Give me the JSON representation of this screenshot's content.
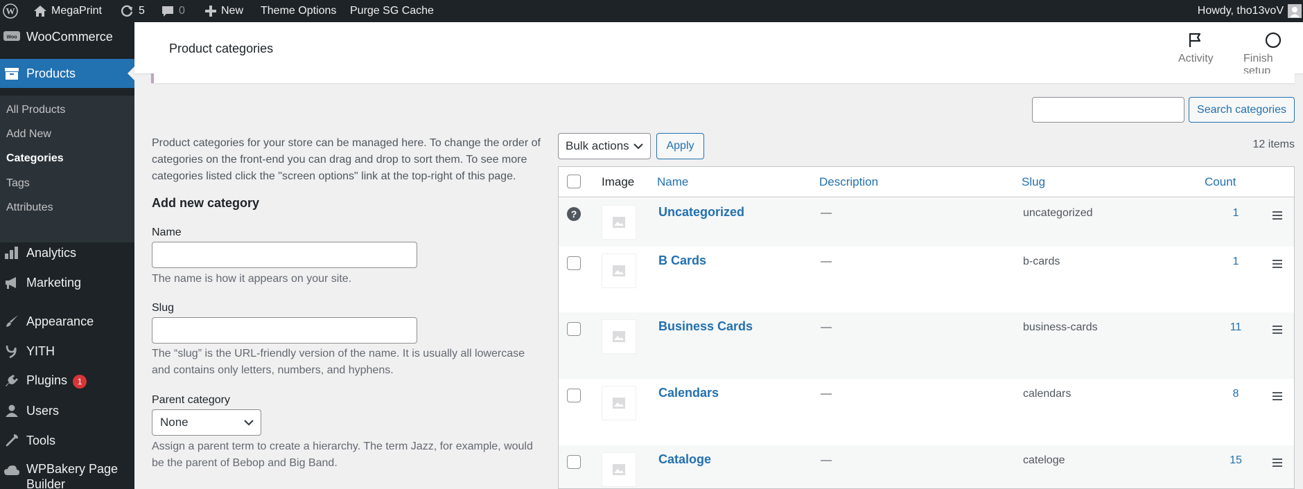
{
  "admin_bar": {
    "site_name": "MegaPrint",
    "updates_count": "5",
    "comments_count": "0",
    "new_label": "New",
    "theme_options": "Theme Options",
    "purge_cache": "Purge SG Cache",
    "greeting": "Howdy, tho13voV"
  },
  "sidebar": {
    "items": [
      {
        "label": "WooCommerce",
        "icon": "woo-icon"
      },
      {
        "label": "Products",
        "icon": "archive-icon"
      },
      {
        "label": "Analytics",
        "icon": "bar-chart-icon"
      },
      {
        "label": "Marketing",
        "icon": "megaphone-icon"
      },
      {
        "label": "Appearance",
        "icon": "paintbrush-icon"
      },
      {
        "label": "YITH",
        "icon": "yith-icon"
      },
      {
        "label": "Plugins",
        "icon": "plug-icon",
        "badge": "1"
      },
      {
        "label": "Users",
        "icon": "user-icon"
      },
      {
        "label": "Tools",
        "icon": "wrench-icon"
      },
      {
        "label": "WPBakery Page Builder",
        "icon": "cloud-icon"
      }
    ],
    "submenu": [
      "All Products",
      "Add New",
      "Categories",
      "Tags",
      "Attributes"
    ]
  },
  "header": {
    "title": "Product categories",
    "activity_label": "Activity",
    "finish_setup_label": "Finish setup"
  },
  "search": {
    "value": "",
    "button_label": "Search categories"
  },
  "form": {
    "intro": "Product categories for your store can be managed here. To change the order of categories on the front-end you can drag and drop to sort them. To see more categories listed click the \"screen options\" link at the top-right of this page.",
    "title": "Add new category",
    "name_label": "Name",
    "name_help": "The name is how it appears on your site.",
    "slug_label": "Slug",
    "slug_help": "The “slug” is the URL-friendly version of the name. It is usually all lowercase and contains only letters, numbers, and hyphens.",
    "parent_label": "Parent category",
    "parent_value": "None",
    "parent_help": "Assign a parent term to create a hierarchy. The term Jazz, for example, would be the parent of Bebop and Big Band."
  },
  "table": {
    "bulk_actions": "Bulk actions",
    "apply_label": "Apply",
    "items_count": "12 items",
    "columns": {
      "image": "Image",
      "name": "Name",
      "description": "Description",
      "slug": "Slug",
      "count": "Count"
    },
    "rows": [
      {
        "name": "Uncategorized",
        "description": "—",
        "slug": "uncategorized",
        "count": "1"
      },
      {
        "name": "B Cards",
        "description": "—",
        "slug": "b-cards",
        "count": "1"
      },
      {
        "name": "Business Cards",
        "description": "—",
        "slug": "business-cards",
        "count": "11"
      },
      {
        "name": "Calendars",
        "description": "—",
        "slug": "calendars",
        "count": "8"
      },
      {
        "name": "Cataloge",
        "description": "—",
        "slug": "cateloge",
        "count": "15"
      }
    ]
  },
  "colors": {
    "admin_dark": "#1d2327",
    "accent_blue": "#2271b1",
    "badge_red": "#d63638"
  }
}
